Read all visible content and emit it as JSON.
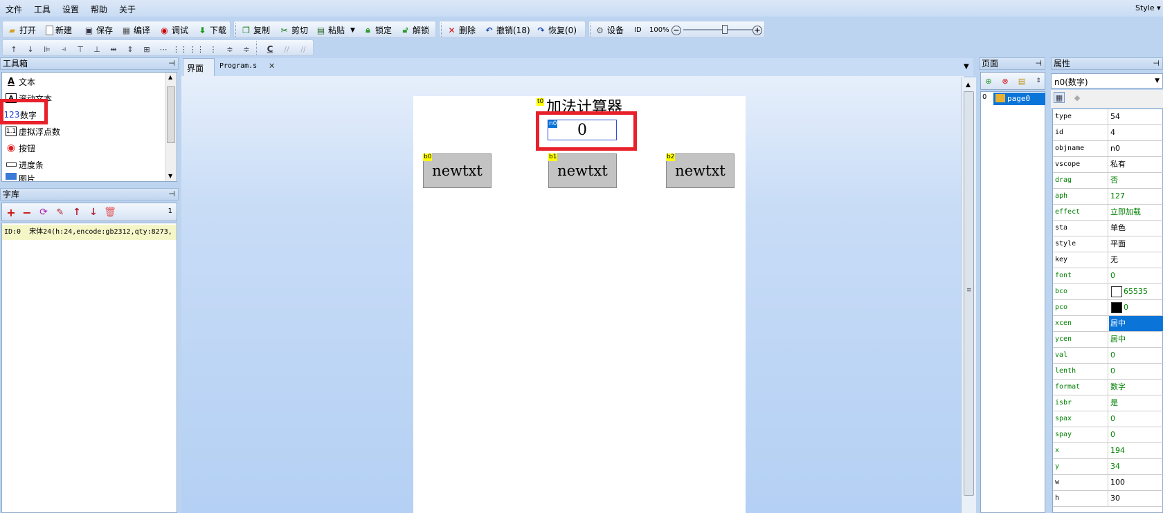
{
  "menubar": {
    "items": [
      "文件",
      "工具",
      "设置",
      "帮助",
      "关于"
    ],
    "style_label": "Style"
  },
  "toolbar": {
    "open": "打开",
    "new": "新建",
    "save": "保存",
    "compile": "编译",
    "debug": "调试",
    "download": "下载",
    "copy": "复制",
    "cut": "剪切",
    "paste": "粘贴",
    "lock": "锁定",
    "unlock": "解锁",
    "delete": "删除",
    "undo": "撤销(18)",
    "redo": "恢复(0)",
    "settings": "设备",
    "id": "ID",
    "zoom": "100%",
    "zoom_level": 0.6,
    "c_label": "C"
  },
  "toolbox": {
    "title": "工具箱",
    "items": [
      {
        "label": "文本",
        "icon": "text-icon"
      },
      {
        "label": "滚动文本",
        "icon": "scroll-text-icon"
      },
      {
        "label": "数字",
        "icon": "number-icon"
      },
      {
        "label": "虚拟浮点数",
        "icon": "float-icon"
      },
      {
        "label": "按钮",
        "icon": "button-icon"
      },
      {
        "label": "进度条",
        "icon": "progress-icon"
      },
      {
        "label": "图片",
        "icon": "picture-icon"
      }
    ],
    "number_icon_text": "123",
    "float_icon_text": "1.1"
  },
  "font_lib": {
    "title": "字库",
    "count": "1",
    "entry": "ID:0  宋体24(h:24,encode:gb2312,qty:8273,"
  },
  "tabs": [
    {
      "label": "界面",
      "active": true
    },
    {
      "label": "Program.s",
      "active": false
    }
  ],
  "canvas": {
    "title": "加法计算器",
    "title_tag": "t0",
    "number_tag": "n0",
    "number_value": "0",
    "buttons": [
      {
        "tag": "b0",
        "label": "newtxt"
      },
      {
        "tag": "b1",
        "label": "newtxt"
      },
      {
        "tag": "b2",
        "label": "newtxt"
      }
    ]
  },
  "pages": {
    "title": "页面",
    "items": [
      {
        "index": "0",
        "label": "page0"
      }
    ]
  },
  "properties": {
    "title": "属性",
    "selector": "n0(数字)",
    "rows": [
      {
        "k": "type",
        "v": "54",
        "kc": "black",
        "vc": "black"
      },
      {
        "k": "id",
        "v": "4",
        "kc": "black",
        "vc": "black"
      },
      {
        "k": "objname",
        "v": "n0",
        "kc": "black",
        "vc": "black"
      },
      {
        "k": "vscope",
        "v": "私有",
        "kc": "black",
        "vc": "black"
      },
      {
        "k": "drag",
        "v": "否",
        "kc": "green",
        "vc": "green"
      },
      {
        "k": "aph",
        "v": "127",
        "kc": "green",
        "vc": "green"
      },
      {
        "k": "effect",
        "v": "立即加载",
        "kc": "green",
        "vc": "green"
      },
      {
        "k": "sta",
        "v": "单色",
        "kc": "black",
        "vc": "black"
      },
      {
        "k": "style",
        "v": "平面",
        "kc": "black",
        "vc": "black"
      },
      {
        "k": "key",
        "v": "无",
        "kc": "black",
        "vc": "black"
      },
      {
        "k": "font",
        "v": "0",
        "kc": "green",
        "vc": "green"
      },
      {
        "k": "bco",
        "v": "65535",
        "kc": "green",
        "vc": "green",
        "swatch": "#ffffff"
      },
      {
        "k": "pco",
        "v": "0",
        "kc": "green",
        "vc": "green",
        "swatch": "#000000"
      },
      {
        "k": "xcen",
        "v": "居中",
        "kc": "green",
        "vc": "white",
        "selected": true
      },
      {
        "k": "ycen",
        "v": "居中",
        "kc": "green",
        "vc": "green"
      },
      {
        "k": "val",
        "v": "0",
        "kc": "green",
        "vc": "green"
      },
      {
        "k": "lenth",
        "v": "0",
        "kc": "green",
        "vc": "green"
      },
      {
        "k": "format",
        "v": "数字",
        "kc": "green",
        "vc": "green"
      },
      {
        "k": "isbr",
        "v": "是",
        "kc": "green",
        "vc": "green"
      },
      {
        "k": "spax",
        "v": "0",
        "kc": "green",
        "vc": "green"
      },
      {
        "k": "spay",
        "v": "0",
        "kc": "green",
        "vc": "green"
      },
      {
        "k": "x",
        "v": "194",
        "kc": "green",
        "vc": "green"
      },
      {
        "k": "y",
        "v": "34",
        "kc": "green",
        "vc": "green"
      },
      {
        "k": "w",
        "v": "100",
        "kc": "black",
        "vc": "black"
      },
      {
        "k": "h",
        "v": "30",
        "kc": "black",
        "vc": "black"
      }
    ]
  },
  "colors": {
    "highlight": "#e8202a",
    "selection": "#0a74d8",
    "workspace": "#c8dcf6"
  }
}
